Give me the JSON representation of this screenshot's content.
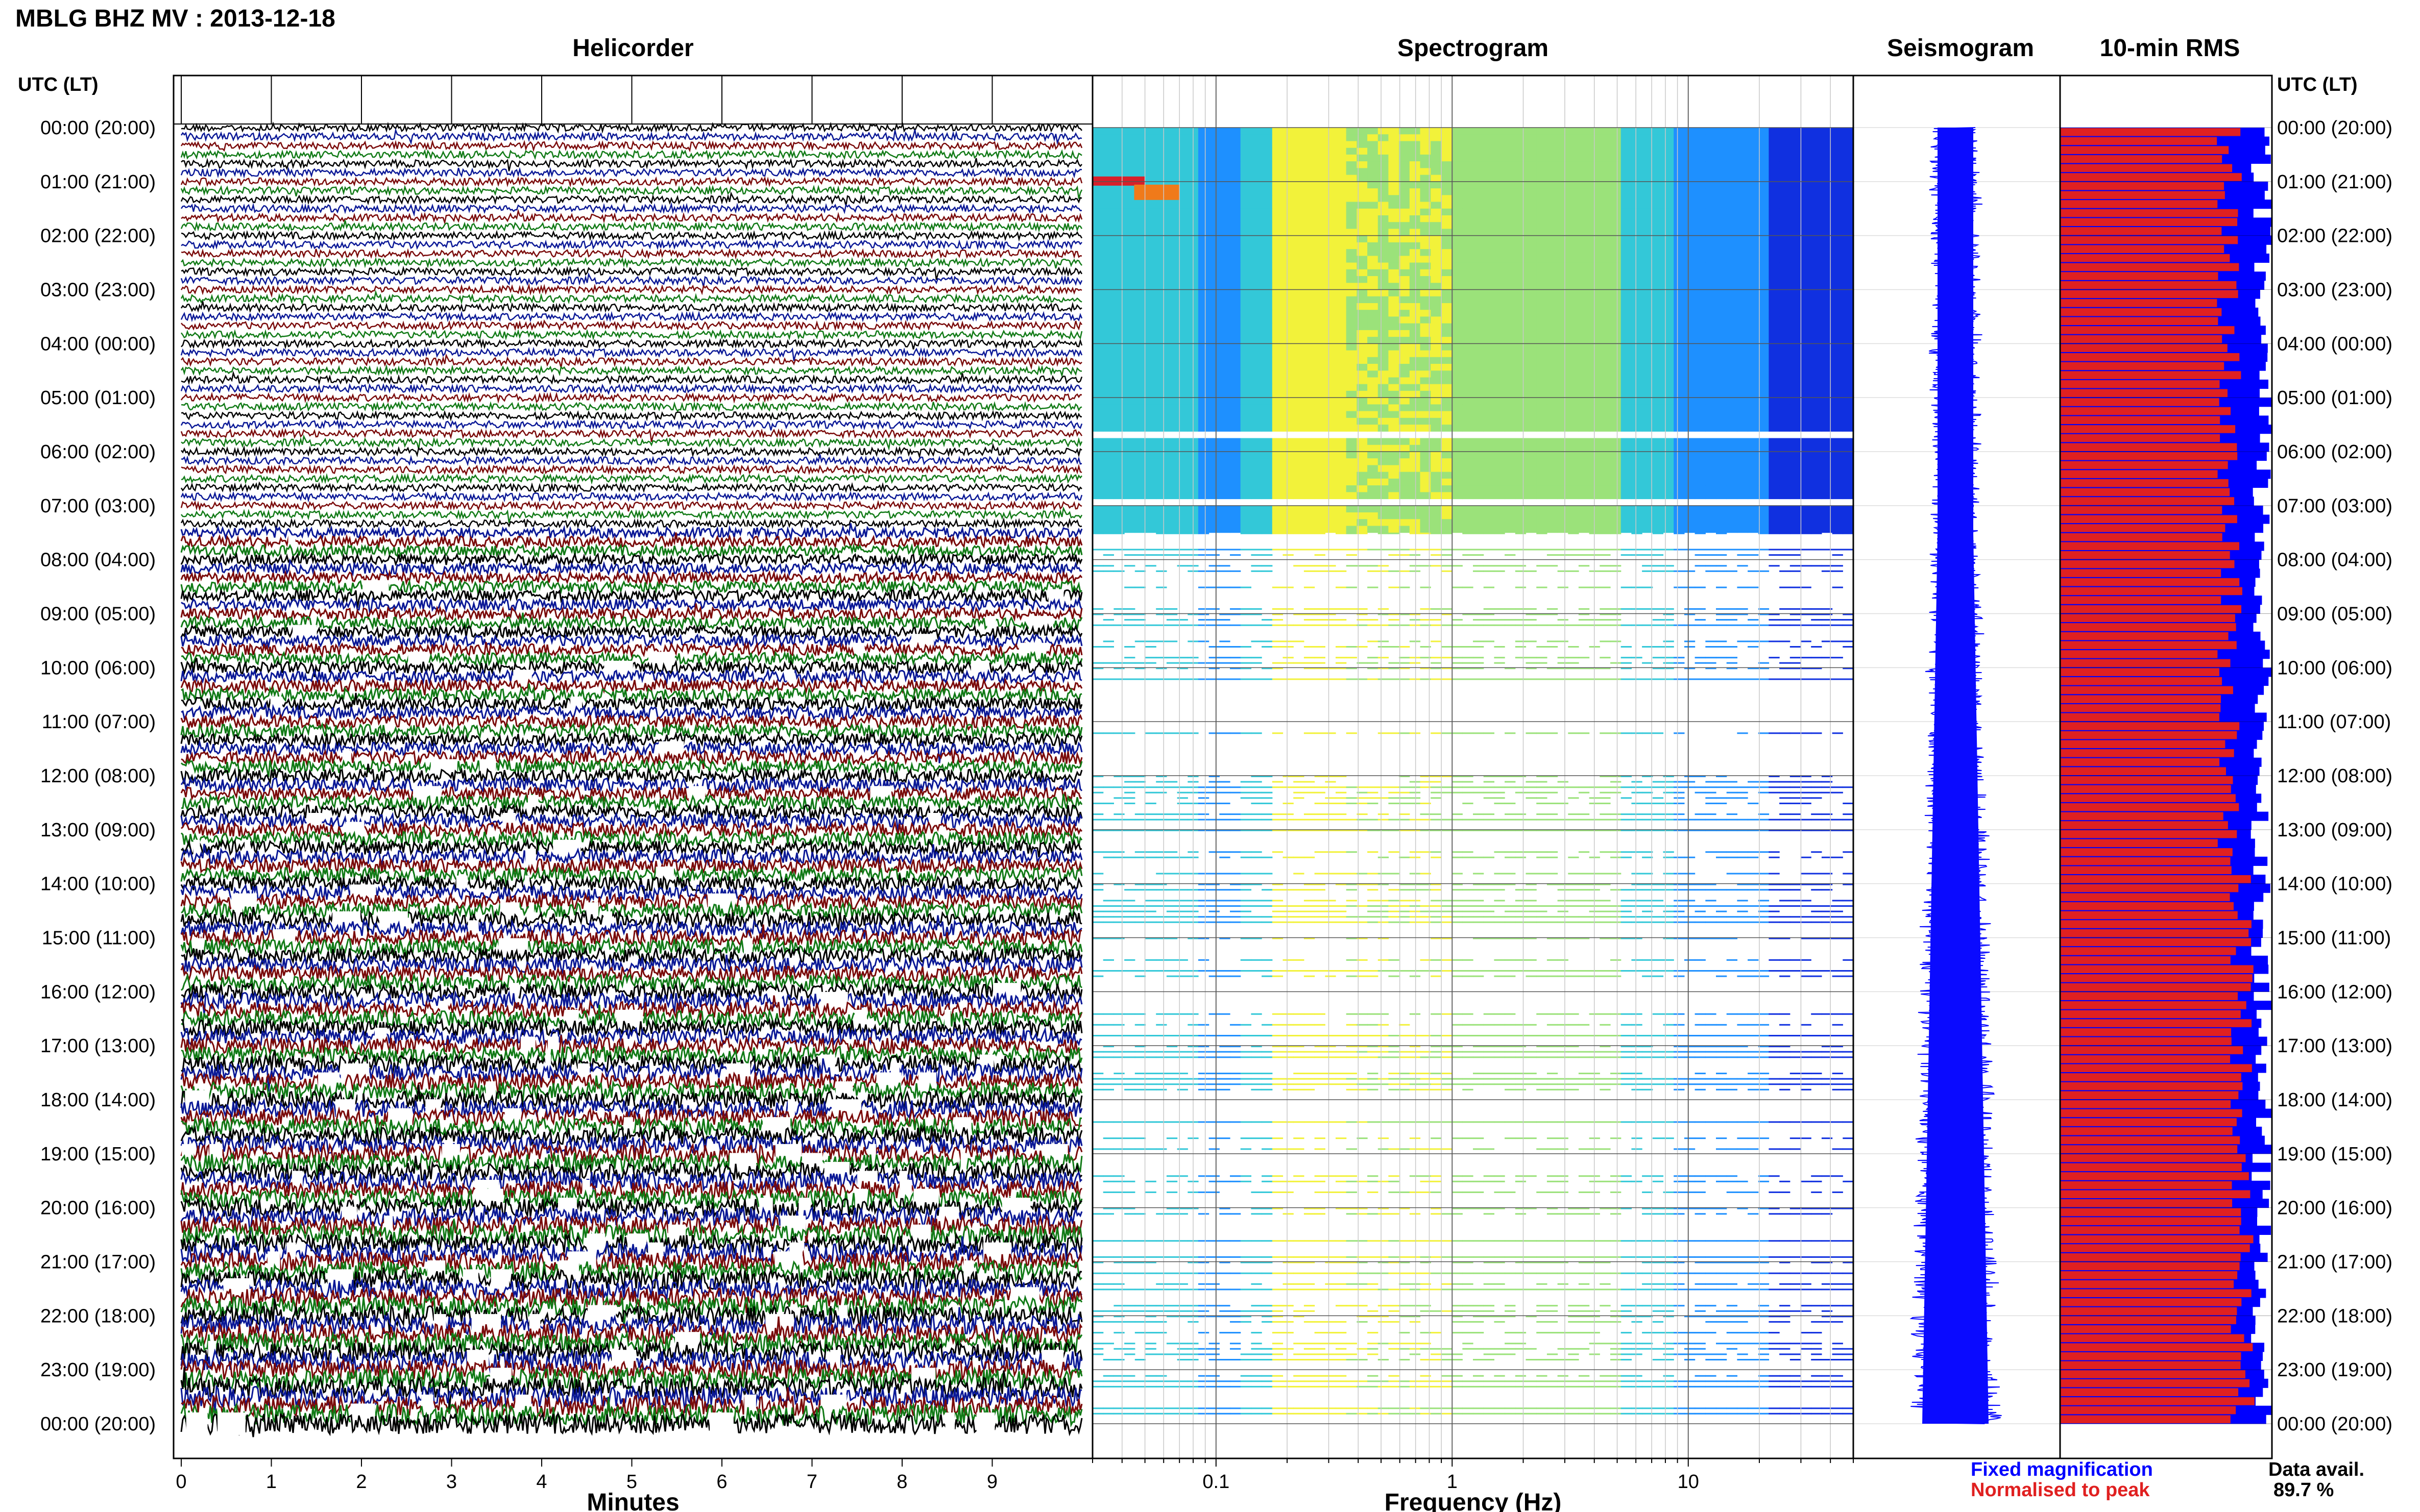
{
  "title": "MBLG BHZ MV : 2013-12-18",
  "time_axis_label": "UTC (LT)",
  "time_labels": [
    "00:00 (20:00)",
    "01:00 (21:00)",
    "02:00 (22:00)",
    "03:00 (23:00)",
    "04:00 (00:00)",
    "05:00 (01:00)",
    "06:00 (02:00)",
    "07:00 (03:00)",
    "08:00 (04:00)",
    "09:00 (05:00)",
    "10:00 (06:00)",
    "11:00 (07:00)",
    "12:00 (08:00)",
    "13:00 (09:00)",
    "14:00 (10:00)",
    "15:00 (11:00)",
    "16:00 (12:00)",
    "17:00 (13:00)",
    "18:00 (14:00)",
    "19:00 (15:00)",
    "20:00 (16:00)",
    "21:00 (17:00)",
    "22:00 (18:00)",
    "23:00 (19:00)",
    "00:00 (20:00)"
  ],
  "panels": {
    "helicorder": "Helicorder",
    "spectrogram": "Spectrogram",
    "seismogram": "Seismogram",
    "rms": "10-min RMS"
  },
  "colors": {
    "trace_cycle": [
      "#000000",
      "#0a1896",
      "#7a0a0a",
      "#117a16"
    ],
    "rms_fixed": "#0000ff",
    "rms_normalised": "#e02020",
    "seismogram": "#0a0aff"
  },
  "chart_data": [
    {
      "type": "line",
      "panel": "Helicorder",
      "xlabel": "Minutes",
      "x_ticks": [
        "0",
        "1",
        "2",
        "3",
        "4",
        "5",
        "6",
        "7",
        "8",
        "9"
      ],
      "xlim": [
        0,
        10
      ],
      "y_range_hours": [
        0,
        24
      ],
      "traces_per_hour": 6,
      "quiet_period_hours": [
        0,
        7.5
      ],
      "noisy_period_hours": [
        7.5,
        24
      ]
    },
    {
      "type": "heatmap",
      "panel": "Spectrogram",
      "xlabel": "Frequency (Hz)",
      "x_scale": "log",
      "x_ticks": [
        "0.1",
        "1",
        "10"
      ],
      "xlim": [
        0.03,
        50
      ],
      "colormap": [
        "#1030e0",
        "#1e90ff",
        "#33c8d8",
        "#9be27a",
        "#f2f23a",
        "#f07a1a",
        "#d8202a"
      ],
      "continuous_data_hours": [
        0,
        7.5
      ],
      "sparse_data_hours": [
        7.5,
        24
      ],
      "peak_band_hz": [
        0.18,
        0.3
      ],
      "event_hour": 1.0,
      "event_band_hz": [
        0.03,
        0.07
      ]
    },
    {
      "type": "line",
      "panel": "Seismogram",
      "y_range_hours": [
        0,
        24
      ],
      "width_profile": "widening toward later hours"
    },
    {
      "type": "bar",
      "panel": "10-min RMS",
      "orientation": "horizontal",
      "bins": 144,
      "legend": [
        "Fixed magnification",
        "Normalised to peak"
      ],
      "typical_fixed_fraction": 0.95,
      "typical_normalised_fraction": 0.8
    }
  ],
  "data_avail_label": "Data avail.",
  "data_avail_value": "89.7 %"
}
